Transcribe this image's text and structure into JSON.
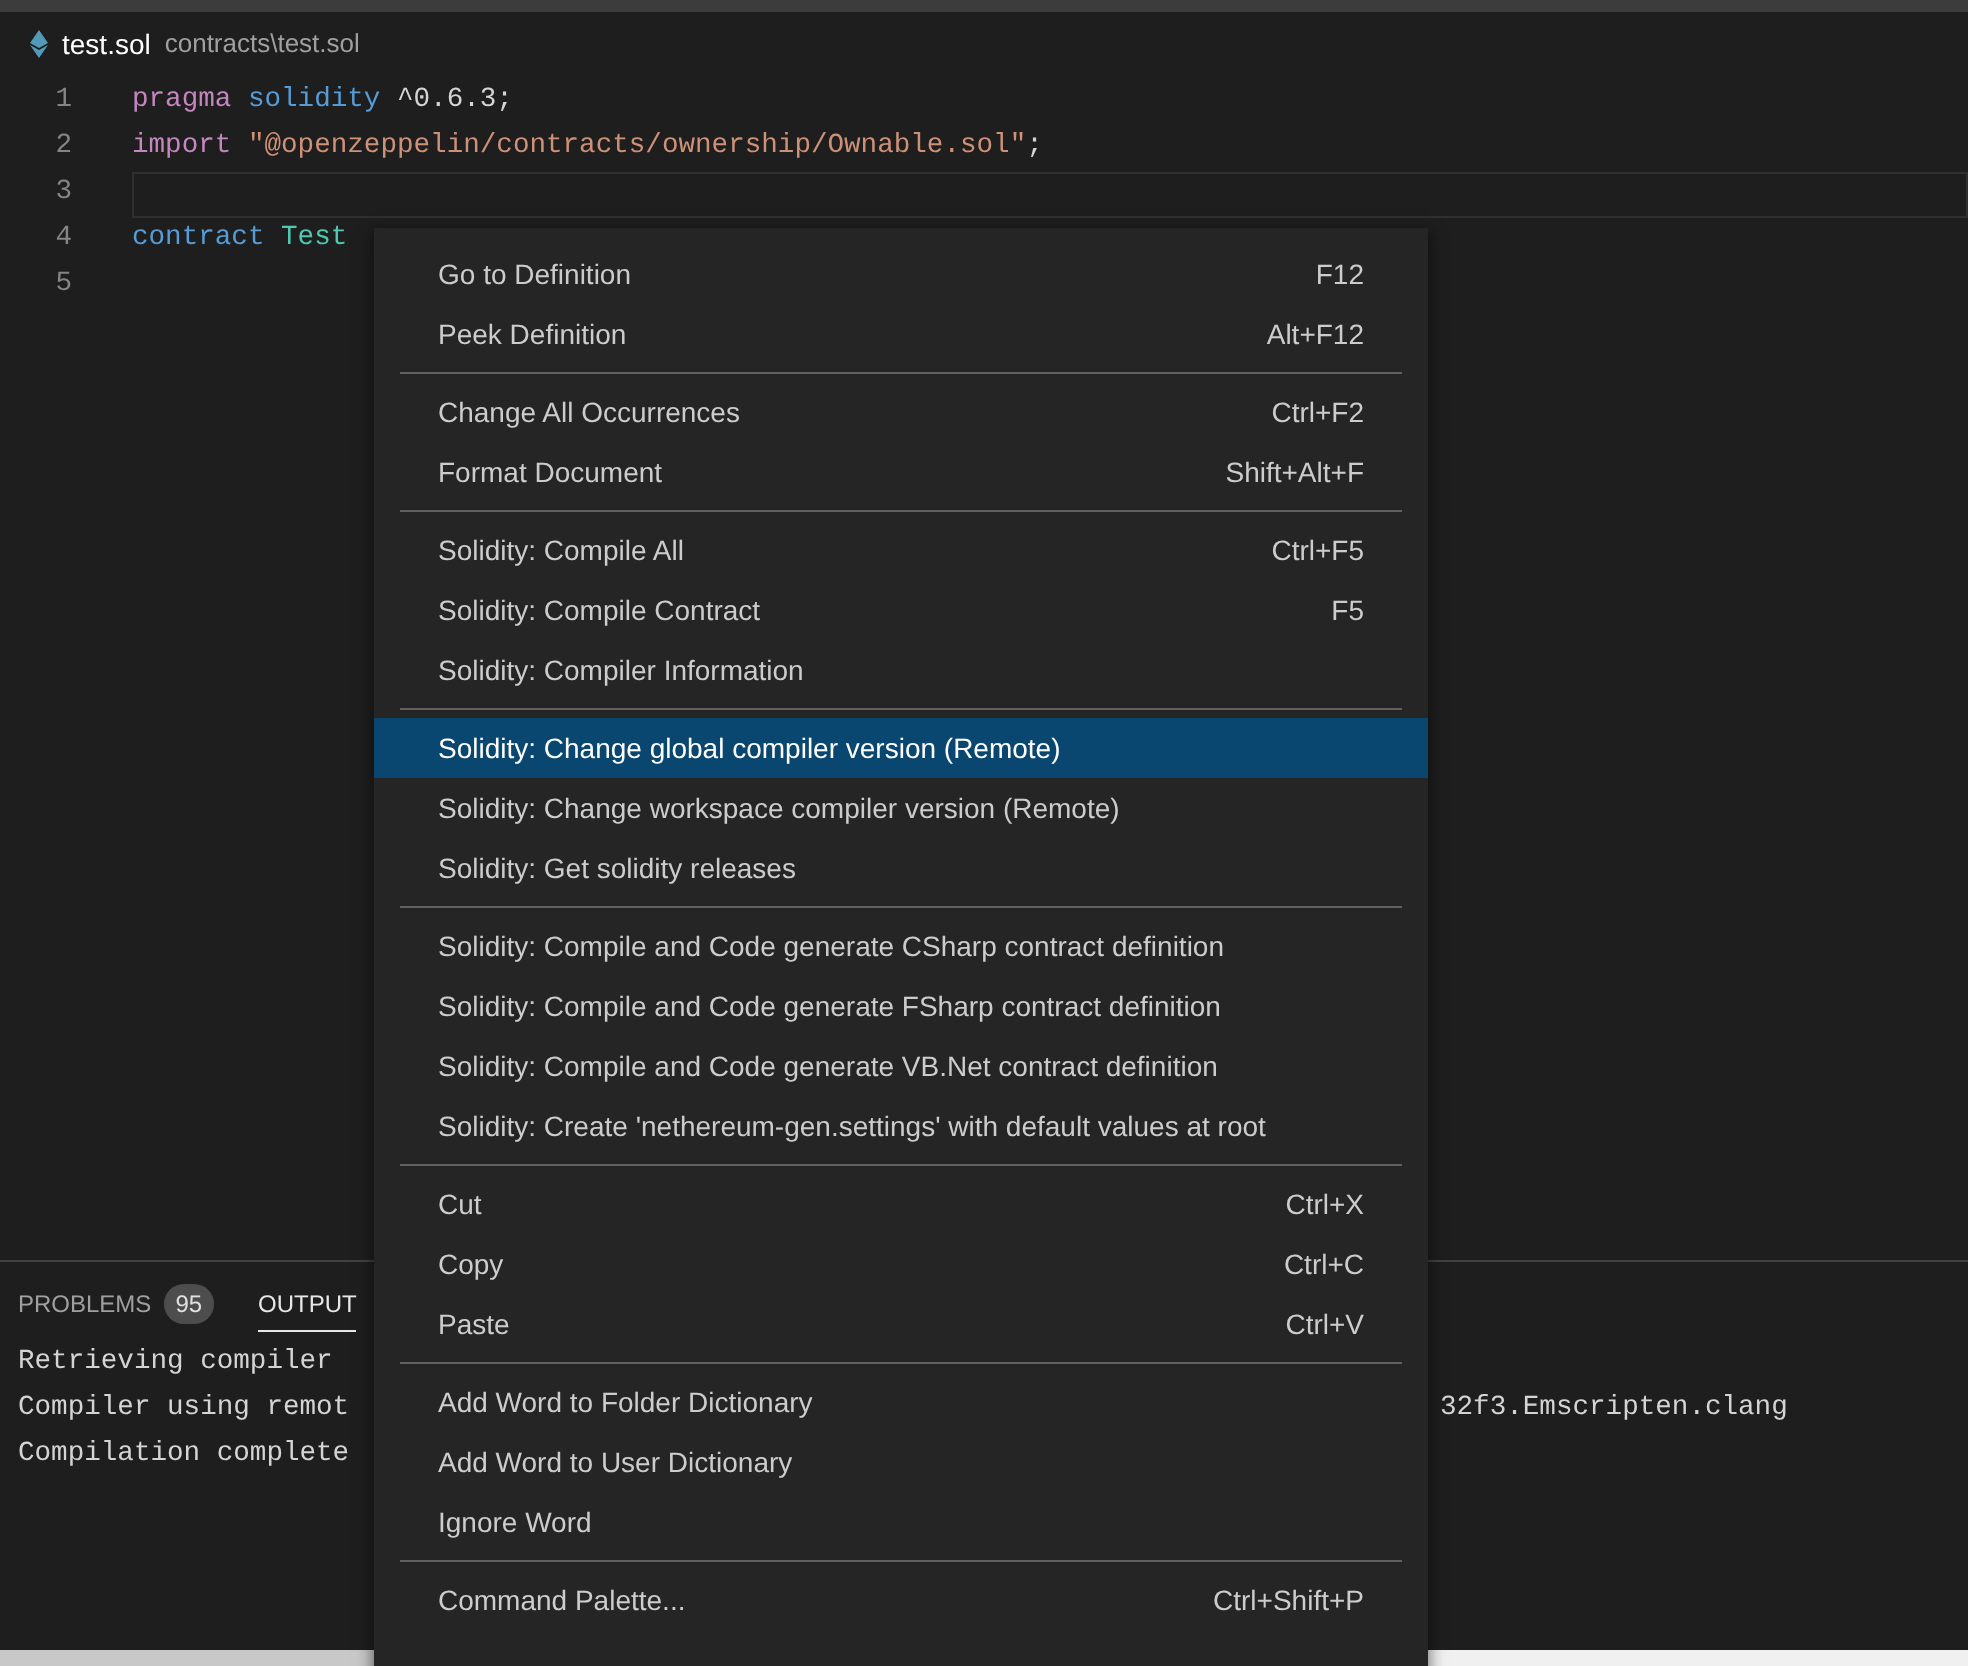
{
  "breadcrumb": {
    "file": "test.sol",
    "path": "contracts\\test.sol"
  },
  "editor": {
    "lines": [
      {
        "number": "1",
        "current": false,
        "tokens": [
          {
            "kind": "keyword",
            "text": "pragma "
          },
          {
            "kind": "type",
            "text": "solidity"
          },
          {
            "kind": "plain",
            "text": " ^0.6.3;"
          }
        ]
      },
      {
        "number": "2",
        "current": false,
        "tokens": [
          {
            "kind": "keyword",
            "text": "import "
          },
          {
            "kind": "string",
            "text": "\"@openzeppelin/contracts/ownership/Ownable.sol\""
          },
          {
            "kind": "plain",
            "text": ";"
          }
        ]
      },
      {
        "number": "3",
        "current": true
      },
      {
        "number": "4",
        "current": false,
        "tokens": [
          {
            "kind": "type",
            "text": "contract "
          },
          {
            "kind": "class",
            "text": "Test"
          }
        ]
      },
      {
        "number": "5",
        "current": false
      }
    ]
  },
  "panel": {
    "tabs": [
      {
        "label": "PROBLEMS",
        "badge": "95",
        "selected": false
      },
      {
        "label": "OUTPUT",
        "selected": true
      }
    ],
    "output": [
      {
        "text": "Retrieving compiler"
      },
      {
        "text": "Compiler using remot",
        "tail": "32f3.Emscripten.clang"
      },
      {
        "text": "Compilation complete"
      }
    ]
  },
  "context_menu": {
    "groups": [
      [
        {
          "label": "Go to Definition",
          "shortcut": "F12",
          "selected": false
        },
        {
          "label": "Peek Definition",
          "shortcut": "Alt+F12",
          "selected": false
        }
      ],
      [
        {
          "label": "Change All Occurrences",
          "shortcut": "Ctrl+F2",
          "selected": false
        },
        {
          "label": "Format Document",
          "shortcut": "Shift+Alt+F",
          "selected": false
        }
      ],
      [
        {
          "label": "Solidity: Compile All",
          "shortcut": "Ctrl+F5",
          "selected": false
        },
        {
          "label": "Solidity: Compile Contract",
          "shortcut": "F5",
          "selected": false
        },
        {
          "label": "Solidity: Compiler Information",
          "selected": false
        }
      ],
      [
        {
          "label": "Solidity: Change global compiler version (Remote)",
          "selected": true
        },
        {
          "label": "Solidity: Change workspace compiler version (Remote)",
          "selected": false
        },
        {
          "label": "Solidity: Get solidity releases",
          "selected": false
        }
      ],
      [
        {
          "label": "Solidity: Compile and Code generate CSharp contract definition",
          "selected": false
        },
        {
          "label": "Solidity: Compile and Code generate FSharp contract definition",
          "selected": false
        },
        {
          "label": "Solidity: Compile and Code generate VB.Net contract definition",
          "selected": false
        },
        {
          "label": "Solidity: Create 'nethereum-gen.settings' with default values at root",
          "selected": false
        }
      ],
      [
        {
          "label": "Cut",
          "shortcut": "Ctrl+X",
          "selected": false
        },
        {
          "label": "Copy",
          "shortcut": "Ctrl+C",
          "selected": false
        },
        {
          "label": "Paste",
          "shortcut": "Ctrl+V",
          "selected": false
        }
      ],
      [
        {
          "label": "Add Word to Folder Dictionary",
          "selected": false
        },
        {
          "label": "Add Word to User Dictionary",
          "selected": false
        },
        {
          "label": "Ignore Word",
          "selected": false
        }
      ],
      [
        {
          "label": "Command Palette...",
          "shortcut": "Ctrl+Shift+P",
          "selected": false
        }
      ]
    ]
  }
}
